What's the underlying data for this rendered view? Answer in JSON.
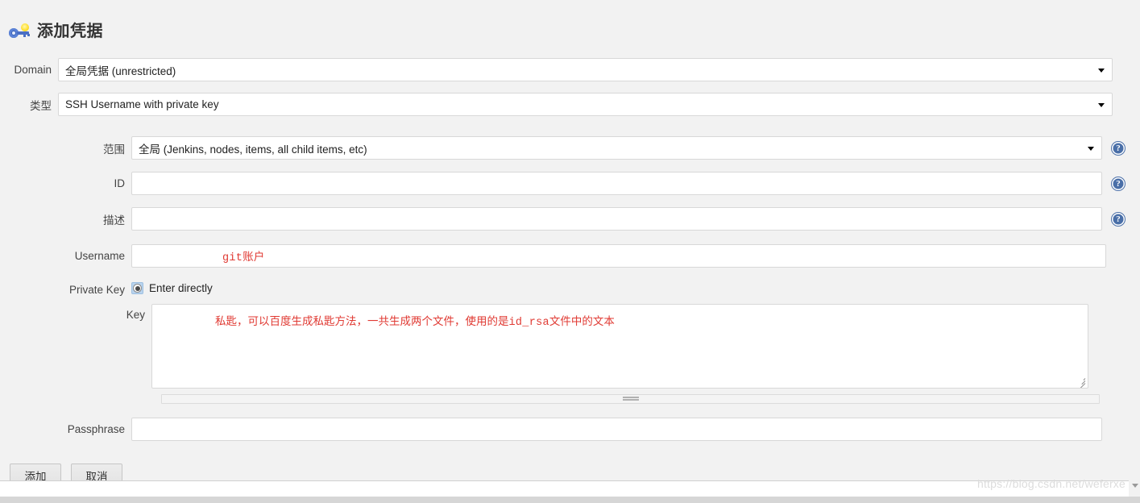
{
  "header": {
    "title": "添加凭据",
    "icon": "key-icon"
  },
  "form": {
    "domain": {
      "label": "Domain",
      "value": "全局凭据 (unrestricted)"
    },
    "type": {
      "label": "类型",
      "value": "SSH Username with private key"
    },
    "scope": {
      "label": "范围",
      "value": "全局 (Jenkins, nodes, items, all child items, etc)",
      "help": "?"
    },
    "id": {
      "label": "ID",
      "value": "",
      "help": "?"
    },
    "description": {
      "label": "描述",
      "value": "",
      "help": "?"
    },
    "username": {
      "label": "Username",
      "value": "",
      "annotation_mono": "git",
      "annotation_cn": "账户"
    },
    "private_key": {
      "label": "Private Key",
      "radio_label": "Enter directly",
      "radio_selected": true,
      "key_label": "Key",
      "key_value": "",
      "annotation_part1": "私匙，可以百度生成私匙方法，一共生成两个文件，使用的是",
      "annotation_mono": "id_rsa",
      "annotation_part2": "文件中的文本"
    },
    "passphrase": {
      "label": "Passphrase",
      "value": ""
    }
  },
  "buttons": {
    "submit": "添加",
    "cancel": "取消"
  },
  "footer": {
    "watermark": "https://blog.csdn.net/weferxe"
  },
  "colors": {
    "annotation_red": "#e03a33",
    "help_blue": "#4a6fa8",
    "page_bg": "#f2f2f2"
  }
}
